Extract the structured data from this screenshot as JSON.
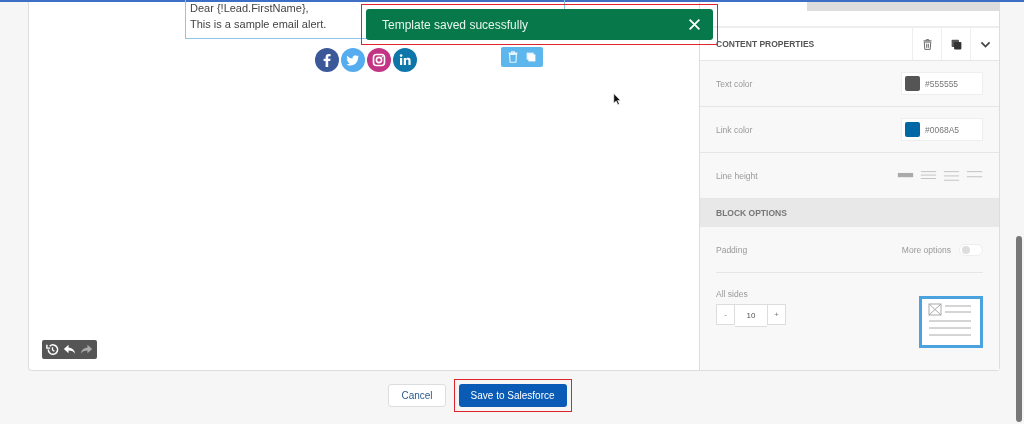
{
  "email": {
    "greeting": "Dear {!Lead.FirstName},",
    "body": "This is a sample email alert."
  },
  "social": [
    {
      "kind": "facebook",
      "color": "#3b5998"
    },
    {
      "kind": "twitter",
      "color": "#55acee"
    },
    {
      "kind": "instagram",
      "color": "#c13584"
    },
    {
      "kind": "linkedin",
      "color": "#0e76a8"
    }
  ],
  "toast": {
    "message": "Template saved sucessfully",
    "annotated": true
  },
  "panel": {
    "title": "CONTENT PROPERTIES",
    "rows": [
      {
        "kind": "color",
        "label": "Text color",
        "value": "#555555",
        "color": "#555555"
      },
      {
        "kind": "color",
        "label": "Link color",
        "value": "#0068A5",
        "color": "#0068a5"
      },
      {
        "kind": "line_height",
        "label": "Line height",
        "options": [
          {
            "selected": true
          },
          {
            "selected": false
          },
          {
            "selected": false
          },
          {
            "selected": false
          }
        ]
      }
    ],
    "block_title": "BLOCK OPTIONS",
    "padding_label": "Padding",
    "more_options": {
      "label": "More options",
      "on": false
    },
    "all_sides": {
      "label": "All sides",
      "minus": "-",
      "value": "10",
      "plus": "+"
    }
  },
  "footer": {
    "cancel": "Cancel",
    "save": "Save to Salesforce",
    "save_annotated": true
  }
}
